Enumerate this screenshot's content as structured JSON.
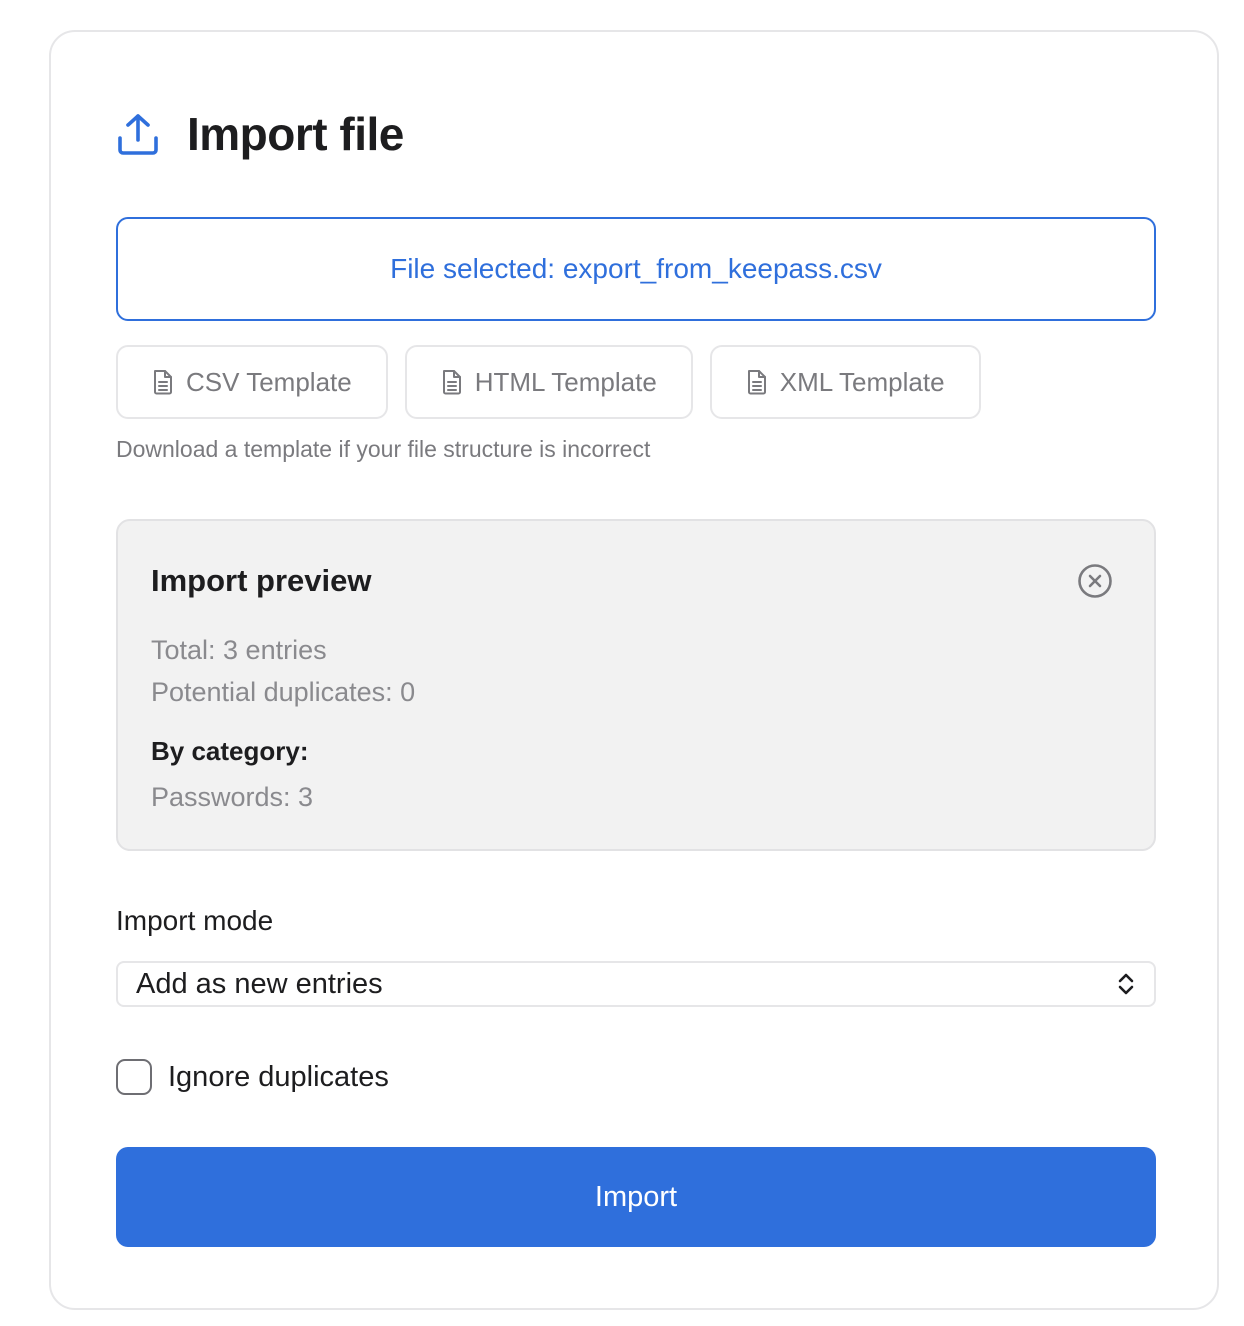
{
  "header": {
    "icon": "upload-icon",
    "title": "Import file"
  },
  "file_selector": {
    "label": "File selected: export_from_keepass.csv"
  },
  "templates": [
    {
      "icon": "document-icon",
      "label": "CSV Template"
    },
    {
      "icon": "document-icon",
      "label": "HTML Template"
    },
    {
      "icon": "document-icon",
      "label": "XML Template"
    }
  ],
  "template_hint": "Download a template if your file structure is incorrect",
  "preview": {
    "title": "Import preview",
    "total": "Total: 3 entries",
    "duplicates": "Potential duplicates: 0",
    "by_category_label": "By category:",
    "categories": [
      "Passwords: 3"
    ],
    "close_icon": "close-circle-icon"
  },
  "import_mode": {
    "label": "Import mode",
    "selected": "Add as new entries"
  },
  "ignore_duplicates": {
    "label": "Ignore duplicates",
    "checked": false
  },
  "import_button": {
    "label": "Import"
  },
  "colors": {
    "accent": "#2f6fdc",
    "preview_bg": "#f2f2f2",
    "muted_text": "#8a8a8e"
  }
}
